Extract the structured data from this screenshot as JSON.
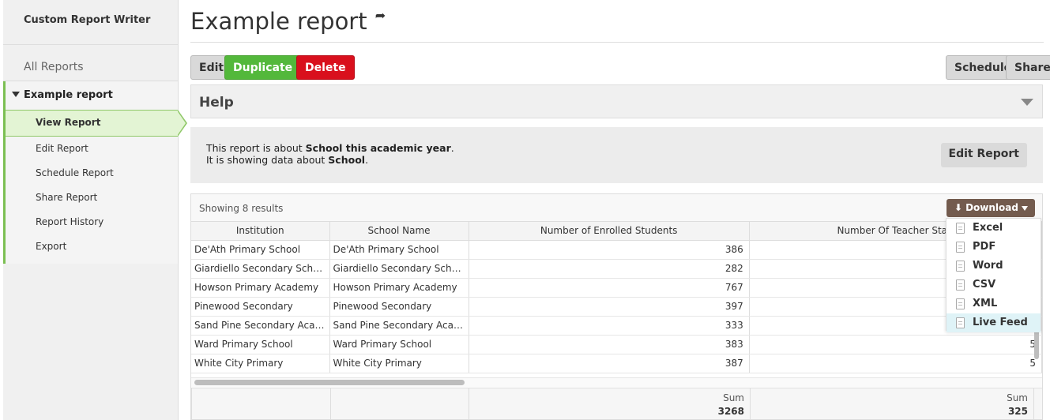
{
  "sidebar": {
    "app_title": "Custom Report Writer",
    "all_reports": "All Reports",
    "group_title": "Example report",
    "items": [
      {
        "label": "View Report",
        "active": true
      },
      {
        "label": "Edit Report"
      },
      {
        "label": "Schedule Report"
      },
      {
        "label": "Share Report"
      },
      {
        "label": "Report History"
      },
      {
        "label": "Export"
      }
    ]
  },
  "page": {
    "title": "Example report",
    "share_icon": "share-arrow-icon"
  },
  "toolbar": {
    "edit": "Edit",
    "duplicate": "Duplicate",
    "delete": "Delete",
    "schedule": "Schedule",
    "share": "Share"
  },
  "help": {
    "title": "Help"
  },
  "about": {
    "line1_prefix": "This report is about ",
    "line1_bold": "School this academic year",
    "line1_suffix": ".",
    "line2_prefix": "It is showing data about ",
    "line2_bold": "School",
    "line2_suffix": ".",
    "edit_button": "Edit Report"
  },
  "results": {
    "count_text": "Showing 8 results",
    "columns": [
      "Institution",
      "School Name",
      "Number of Enrolled Students",
      "Number Of Teacher Staff"
    ],
    "rows": [
      [
        "De'Ath Primary School",
        "De'Ath Primary School",
        "386",
        ""
      ],
      [
        "Giardiello Secondary School",
        "Giardiello Secondary School",
        "282",
        ""
      ],
      [
        "Howson Primary Academy",
        "Howson Primary Academy",
        "767",
        ""
      ],
      [
        "Pinewood Secondary",
        "Pinewood Secondary",
        "397",
        ""
      ],
      [
        "Sand Pine Secondary Acade...",
        "Sand Pine Secondary Academy",
        "333",
        ""
      ],
      [
        "Ward Primary School",
        "Ward Primary School",
        "383",
        "5"
      ],
      [
        "White City Primary",
        "White City Primary",
        "387",
        "5"
      ]
    ],
    "footer": {
      "sum_label": "Sum",
      "students_sum": "3268",
      "staff_sum": "325"
    }
  },
  "download": {
    "label": "Download",
    "options": [
      {
        "label": "Excel",
        "icon": "excel-file-icon"
      },
      {
        "label": "PDF",
        "icon": "pdf-file-icon"
      },
      {
        "label": "Word",
        "icon": "word-file-icon"
      },
      {
        "label": "CSV",
        "icon": "csv-file-icon"
      },
      {
        "label": "XML",
        "icon": "xml-file-icon"
      },
      {
        "label": "Live Feed",
        "icon": "live-feed-file-icon",
        "highlighted": true
      }
    ]
  },
  "colors": {
    "green": "#53b83b",
    "red": "#d9101d",
    "download_brown": "#735b4e",
    "active_nav": "#e3f4d4"
  }
}
